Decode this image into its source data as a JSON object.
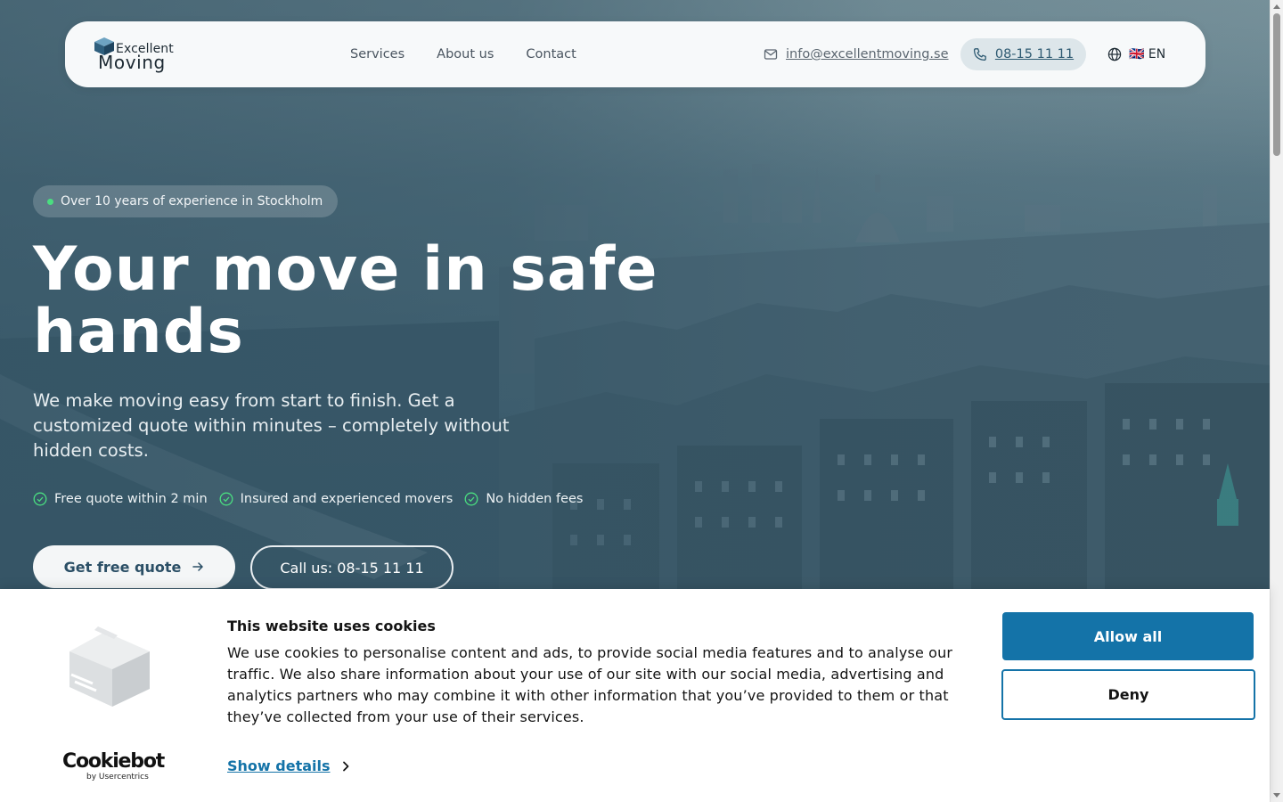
{
  "header": {
    "logo_line1": "Excellent",
    "logo_line2": "Moving",
    "nav": [
      {
        "label": "Services"
      },
      {
        "label": "About us"
      },
      {
        "label": "Contact"
      }
    ],
    "email": "info@excellentmoving.se",
    "phone": "08-15 11 11",
    "language": "🇬🇧 EN"
  },
  "hero": {
    "badge": "Over 10 years of experience in Stockholm",
    "title": "Your move in safe hands",
    "lead": "We make moving easy from start to finish. Get a customized quote within minutes – completely without hidden costs.",
    "checks": [
      "Free quote within 2 min",
      "Insured and experienced movers",
      "No hidden fees"
    ],
    "cta_primary": "Get free quote",
    "cta_secondary": "Call us: 08-15 11 11"
  },
  "cookie_banner": {
    "title": "This website uses cookies",
    "text": "We use cookies to personalise content and ads, to provide social media features and to analyse our traffic. We also share information about your use of our site with our social media, advertising and analytics partners who may combine it with other information that you’ve provided to them or that they’ve collected from your use of their services.",
    "show_details": "Show details",
    "allow_all": "Allow all",
    "deny": "Deny",
    "brand": "Cookiebot",
    "brand_sub": "by Usercentrics"
  },
  "colors": {
    "accent_blue": "#1473a8",
    "pill_bg": "#dde6ea",
    "check_green": "#4ade80"
  },
  "icons": [
    "cube-logo-icon",
    "mail-icon",
    "phone-icon",
    "globe-icon",
    "check-circle-icon",
    "arrow-right-icon",
    "chevron-right-icon",
    "cookie-box-icon"
  ]
}
